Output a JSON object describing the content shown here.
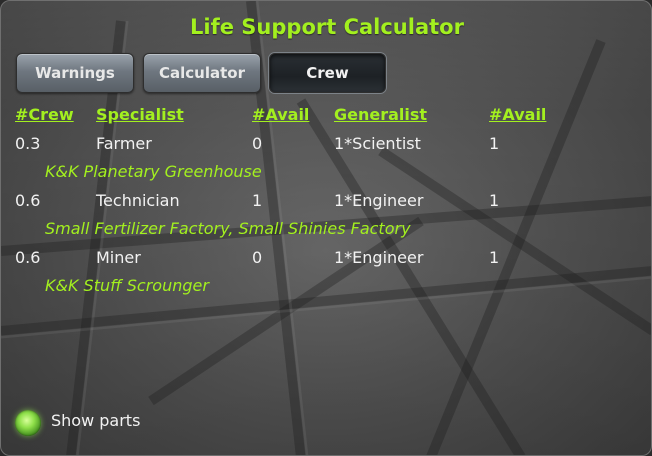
{
  "window": {
    "title": "Life Support Calculator"
  },
  "tabs": [
    {
      "label": "Warnings",
      "active": false
    },
    {
      "label": "Calculator",
      "active": false
    },
    {
      "label": "Crew",
      "active": true
    }
  ],
  "table": {
    "headers": [
      "#Crew",
      "Specialist",
      "#Avail",
      "Generalist",
      "#Avail"
    ],
    "rows": [
      {
        "crew": "0.3",
        "specialist": "Farmer",
        "avail": "0",
        "generalist": "1*Scientist",
        "gen_avail": "1",
        "parts": "K&K Planetary Greenhouse"
      },
      {
        "crew": "0.6",
        "specialist": "Technician",
        "avail": "1",
        "generalist": "1*Engineer",
        "gen_avail": "1",
        "parts": "Small Fertilizer Factory, Small Shinies Factory"
      },
      {
        "crew": "0.6",
        "specialist": "Miner",
        "avail": "0",
        "generalist": "1*Engineer",
        "gen_avail": "1",
        "parts": "K&K Stuff Scrounger"
      }
    ]
  },
  "show_parts": {
    "label": "Show parts",
    "checked": true
  },
  "colors": {
    "accent": "#a3f01f",
    "text": "#f2f2f2"
  }
}
